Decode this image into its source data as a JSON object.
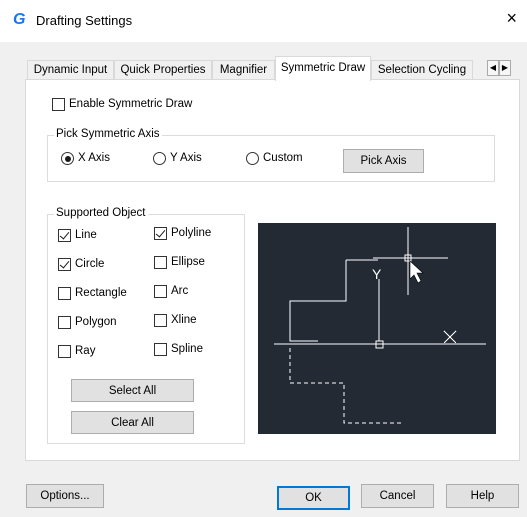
{
  "window": {
    "title": "Drafting Settings",
    "app_icon": "G",
    "close_glyph": "×"
  },
  "tabs": [
    {
      "label": "Dynamic Input"
    },
    {
      "label": "Quick Properties"
    },
    {
      "label": "Magnifier"
    },
    {
      "label": "Symmetric Draw",
      "active": true
    },
    {
      "label": "Selection Cycling"
    }
  ],
  "tab_scroll": {
    "left": "◀",
    "right": "▶"
  },
  "enable": {
    "label": "Enable Symmetric Draw",
    "checked": false
  },
  "axis_group": {
    "title": "Pick Symmetric Axis",
    "options": [
      {
        "label": "X Axis",
        "checked": true
      },
      {
        "label": "Y Axis",
        "checked": false
      },
      {
        "label": "Custom",
        "checked": false
      }
    ],
    "pick_button": "Pick Axis"
  },
  "objects_group": {
    "title": "Supported Object",
    "items": [
      {
        "label": "Line",
        "checked": true
      },
      {
        "label": "Polyline",
        "checked": true
      },
      {
        "label": "Circle",
        "checked": true
      },
      {
        "label": "Ellipse",
        "checked": false
      },
      {
        "label": "Rectangle",
        "checked": false
      },
      {
        "label": "Arc",
        "checked": false
      },
      {
        "label": "Polygon",
        "checked": false
      },
      {
        "label": "Xline",
        "checked": false
      },
      {
        "label": "Ray",
        "checked": false
      },
      {
        "label": "Spline",
        "checked": false
      }
    ],
    "select_all": "Select All",
    "clear_all": "Clear All"
  },
  "preview": {
    "y_label": "Y",
    "background": "#232a34",
    "line_color": "#ffffff"
  },
  "footer": {
    "options": "Options...",
    "ok": "OK",
    "cancel": "Cancel",
    "help": "Help"
  },
  "colors": {
    "dialog_bg": "#f0f0f0",
    "panel_bg": "#ffffff",
    "accent": "#1a73e8",
    "default_border": "#0078d7"
  }
}
